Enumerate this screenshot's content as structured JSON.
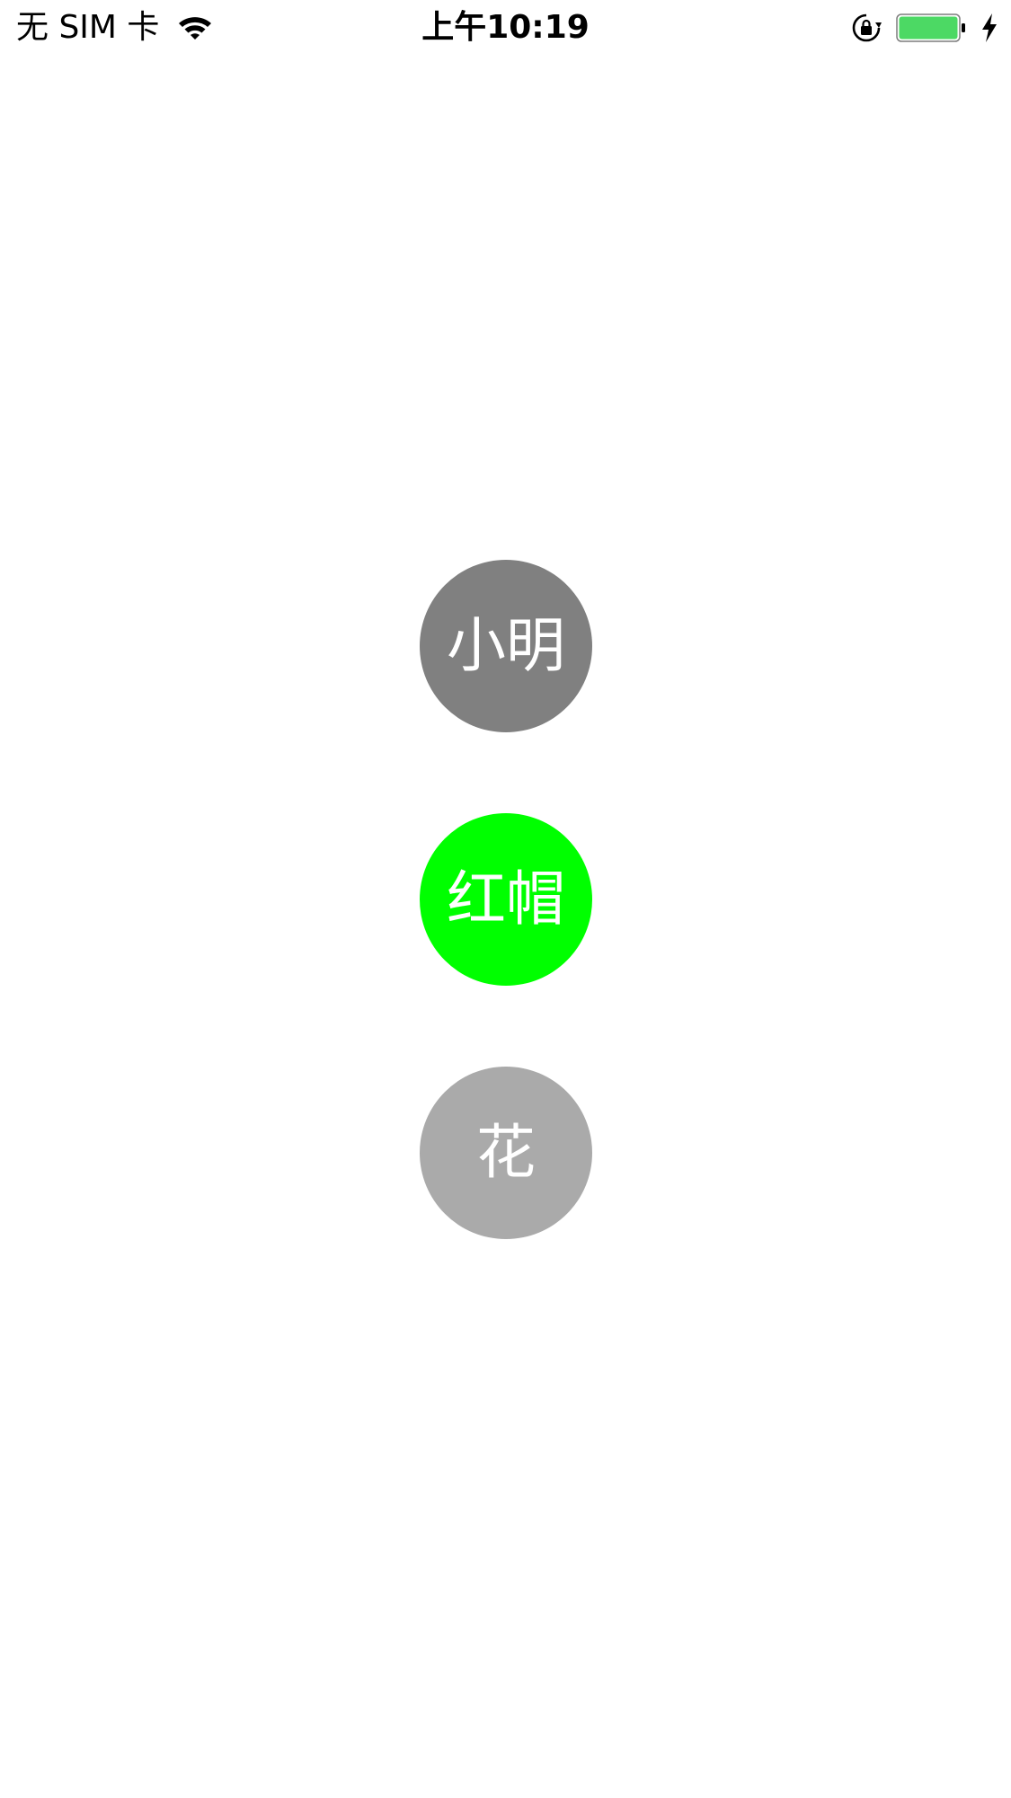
{
  "status_bar": {
    "carrier": "无 SIM 卡",
    "time": "上午10:19",
    "icons": {
      "wifi": "wifi-icon",
      "rotation_lock": "lock-rotation-icon",
      "battery": "battery-icon",
      "charging": "charging-icon"
    },
    "battery_level": 1.0,
    "battery_color": "#4CD964"
  },
  "circles": [
    {
      "label": "小明",
      "color": "#808080"
    },
    {
      "label": "红帽",
      "color": "#00FF00"
    },
    {
      "label": "花",
      "color": "#AAAAAA"
    }
  ]
}
